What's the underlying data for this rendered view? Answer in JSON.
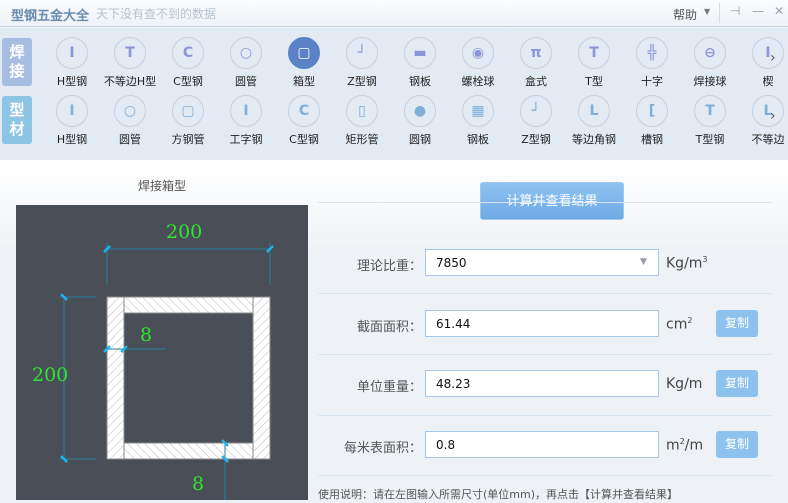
{
  "title": {
    "app": "型钢五金大全",
    "slogan": "天下没有查不到的数据",
    "help": "帮助",
    "pin": "⊣",
    "minimize": "—",
    "close": "✕"
  },
  "tabs": {
    "weld": "焊\n接",
    "profile": "型\n材"
  },
  "weld_items": [
    {
      "label": "H型钢",
      "glyph": "I"
    },
    {
      "label": "不等边H型",
      "glyph": "T"
    },
    {
      "label": "C型钢",
      "glyph": "C"
    },
    {
      "label": "圆管",
      "glyph": "○"
    },
    {
      "label": "箱型",
      "glyph": "▢"
    },
    {
      "label": "Z型钢",
      "glyph": "┘"
    },
    {
      "label": "钢板",
      "glyph": "▬"
    },
    {
      "label": "螺栓球",
      "glyph": "◉"
    },
    {
      "label": "盒式",
      "glyph": "π"
    },
    {
      "label": "T型",
      "glyph": "T"
    },
    {
      "label": "十字",
      "glyph": "╬"
    },
    {
      "label": "焊接球",
      "glyph": "⊖"
    },
    {
      "label": "楔",
      "glyph": "I"
    }
  ],
  "profile_items": [
    {
      "label": "H型钢",
      "glyph": "I"
    },
    {
      "label": "圆管",
      "glyph": "○"
    },
    {
      "label": "方钢管",
      "glyph": "▢"
    },
    {
      "label": "工字钢",
      "glyph": "I"
    },
    {
      "label": "C型钢",
      "glyph": "C"
    },
    {
      "label": "矩形管",
      "glyph": "▯"
    },
    {
      "label": "圆钢",
      "glyph": "●"
    },
    {
      "label": "钢板",
      "glyph": "▦"
    },
    {
      "label": "Z型钢",
      "glyph": "┘"
    },
    {
      "label": "等边角钢",
      "glyph": "L"
    },
    {
      "label": "槽钢",
      "glyph": "["
    },
    {
      "label": "T型钢",
      "glyph": "T"
    },
    {
      "label": "不等边",
      "glyph": "L"
    }
  ],
  "panel": {
    "title": "焊接箱型",
    "width": "200",
    "height": "200",
    "web_t": "8",
    "flange_t": "8"
  },
  "calc_button": "计算并查看结果",
  "rows": [
    {
      "label": "理论比重：",
      "value": "7850",
      "unit": "Kg/m",
      "sup": "3"
    },
    {
      "label": "截面面积：",
      "value": "61.44",
      "unit": "cm",
      "sup": "2",
      "copy": "复制"
    },
    {
      "label": "单位重量：",
      "value": "48.23",
      "unit": "Kg/m",
      "copy": "复制"
    },
    {
      "label": "每米表面积：",
      "value": "0.8",
      "unit": "m",
      "sup": "2",
      "unit2": "/m",
      "copy": "复制"
    }
  ],
  "usage": "使用说明：请在左图输入所需尺寸(单位mm)，再点击【计算并查看结果】"
}
